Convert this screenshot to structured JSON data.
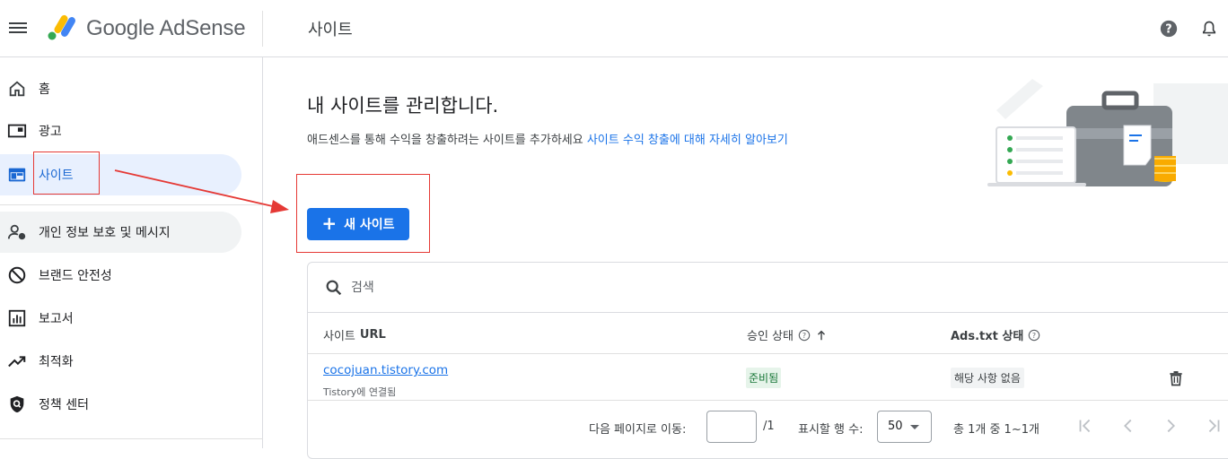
{
  "header": {
    "brand": "Google AdSense",
    "page_title": "사이트"
  },
  "sidebar": {
    "items": [
      {
        "label": "홈",
        "icon": "home-icon"
      },
      {
        "label": "광고",
        "icon": "ads-icon"
      },
      {
        "label": "사이트",
        "icon": "sites-icon",
        "active": true
      },
      {
        "label": "개인 정보 보호 및 메시지",
        "icon": "privacy-icon"
      },
      {
        "label": "브랜드 안전성",
        "icon": "block-icon"
      },
      {
        "label": "보고서",
        "icon": "report-icon"
      },
      {
        "label": "최적화",
        "icon": "trending-icon"
      },
      {
        "label": "정책 센터",
        "icon": "policy-icon"
      }
    ]
  },
  "main": {
    "headline": "내 사이트를 관리합니다.",
    "description": "애드센스를 통해 수익을 창출하려는 사이트를 추가하세요 ",
    "learn_more_link": "사이트 수익 창출에 대해 자세히 알아보기",
    "new_site_button": "새 사이트"
  },
  "table": {
    "search_placeholder": "검색",
    "columns": {
      "site_url_prefix": "사이트",
      "site_url_bold": "URL",
      "approval_status": "승인 상태",
      "ads_txt_status": "Ads.txt 상태"
    },
    "rows": [
      {
        "url": "cocojuan.tistory.com",
        "connected": "Tistory에 연결됨",
        "approval": "준비됨",
        "ads_txt": "해당 사항 없음"
      }
    ],
    "pager": {
      "goto_label": "다음 페이지로 이동:",
      "page_total": "/1",
      "rows_label": "표시할 행 수:",
      "rows_value": "50",
      "range_text": "총 1개 중 1~1개"
    }
  },
  "colors": {
    "accent": "#1a73e8",
    "annotation": "#e53935",
    "active_bg": "#e8f0fe"
  }
}
